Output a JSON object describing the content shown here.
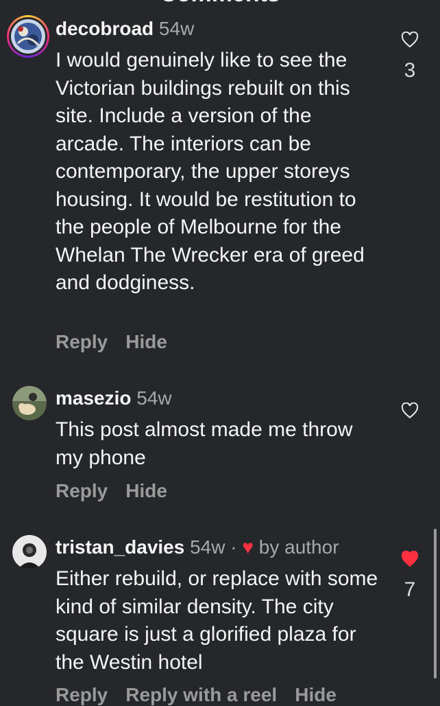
{
  "header": {
    "title": "Comments"
  },
  "comments": [
    {
      "username": "decobroad",
      "time": "54w",
      "text": "I would genuinely like to see the Victorian buildings rebuilt on this site. Include a version of the arcade. The interiors can be contemporary, the upper storeys housing. It would be restitution to the people of Melbourne for the Whelan The Wrecker era of greed and dodginess.",
      "actions": [
        "Reply",
        "Hide"
      ],
      "like_count": "3",
      "liked": false
    },
    {
      "username": "masezio",
      "time": "54w",
      "text": "This post almost made me throw my phone",
      "actions": [
        "Reply",
        "Hide"
      ],
      "liked": false
    },
    {
      "username": "tristan_davies",
      "time": "54w",
      "separator": " · ",
      "author_badge": "by author",
      "text": "Either rebuild, or replace with some kind of similar density. The city square is just a glorified plaza for the Westin hotel",
      "actions": [
        "Reply",
        "Reply with a reel",
        "Hide"
      ],
      "like_count": "7",
      "liked": true
    }
  ],
  "colors": {
    "background": "#26272b",
    "heart_liked": "#ff3040",
    "muted": "#a8a8a8"
  }
}
